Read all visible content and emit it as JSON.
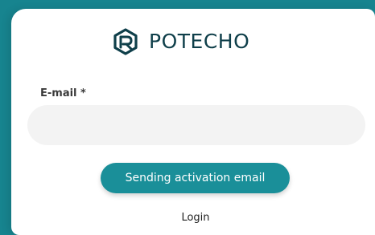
{
  "brand": {
    "name": "POTECHO",
    "icon": "potecho-logo-icon",
    "color": "#0f3f4a"
  },
  "form": {
    "email_label": "E-mail *",
    "email_value": "",
    "email_placeholder": ""
  },
  "actions": {
    "send_activation_label": "Sending activation email",
    "login_label": "Login"
  },
  "colors": {
    "accent": "#1a8f99",
    "input_bg": "#f3f3f3"
  }
}
